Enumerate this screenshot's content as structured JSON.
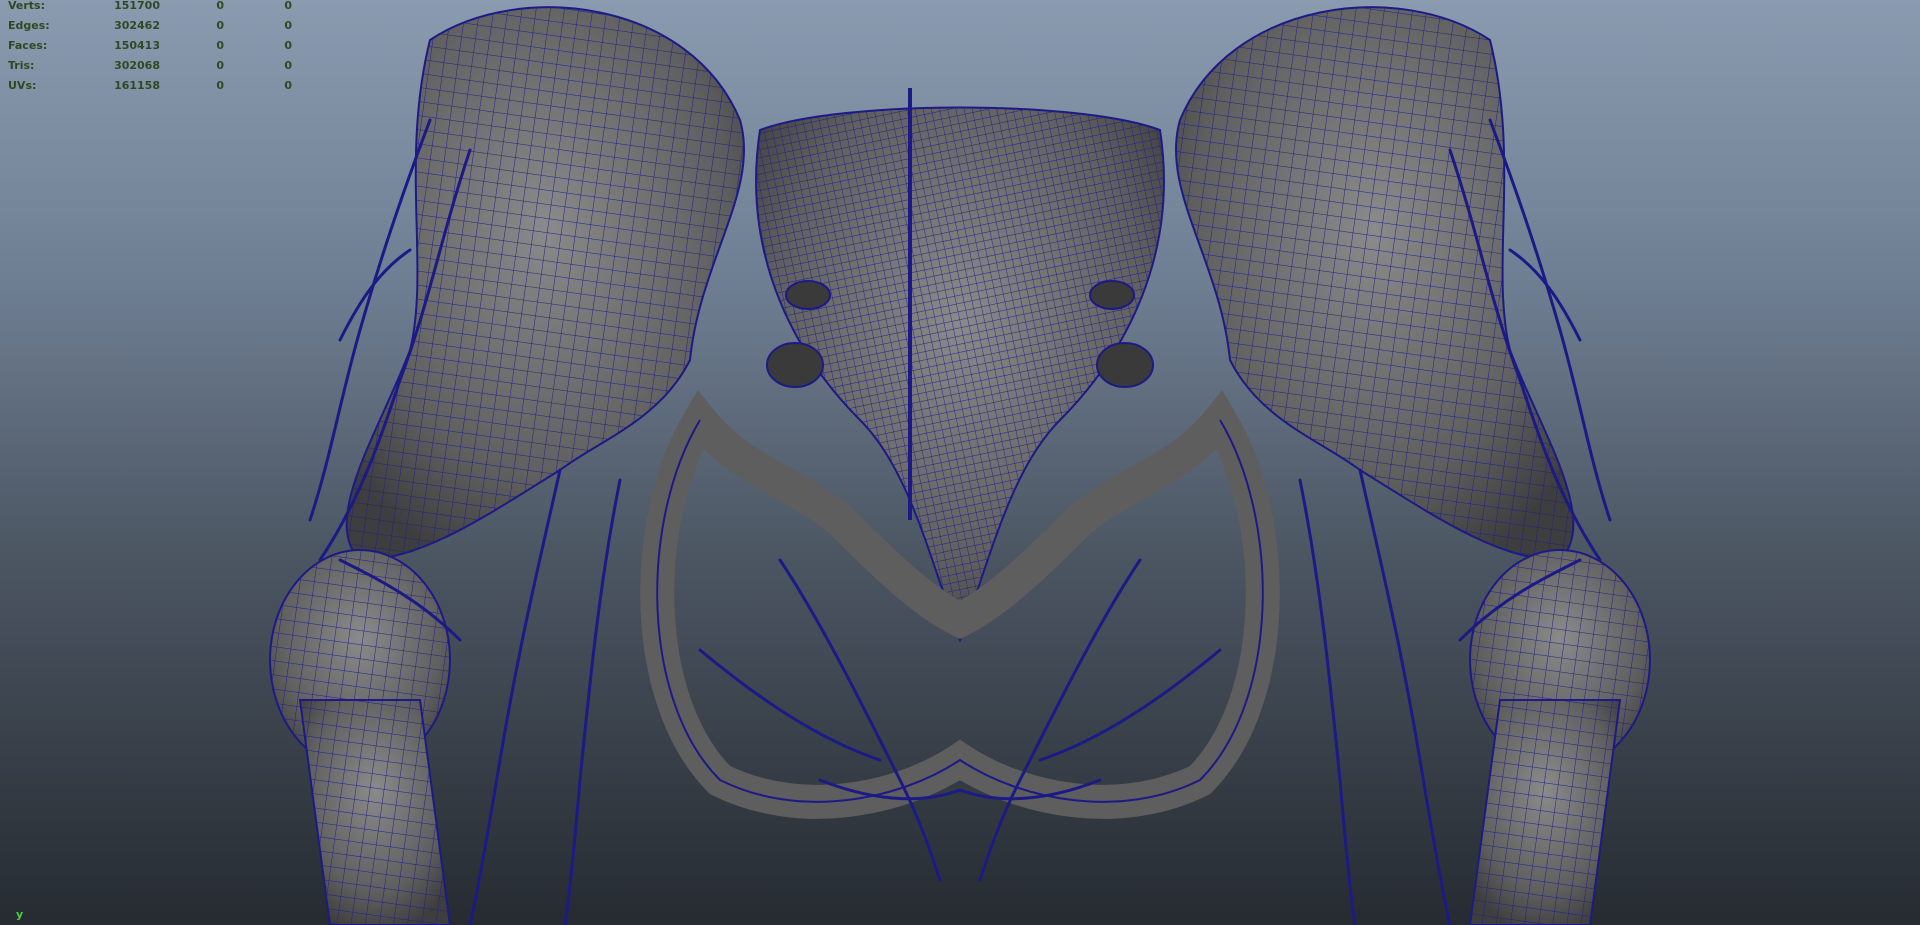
{
  "hud": {
    "rows": [
      {
        "label": "Verts:",
        "v1": "151700",
        "v2": "0",
        "v3": "0"
      },
      {
        "label": "Edges:",
        "v1": "302462",
        "v2": "0",
        "v3": "0"
      },
      {
        "label": "Faces:",
        "v1": "150413",
        "v2": "0",
        "v3": "0"
      },
      {
        "label": "Tris:",
        "v1": "302068",
        "v2": "0",
        "v3": "0"
      },
      {
        "label": "UVs:",
        "v1": "161158",
        "v2": "0",
        "v3": "0"
      }
    ]
  },
  "axis": {
    "label": "y"
  },
  "colors": {
    "bg_top": "#8a9aaf",
    "bg_bottom": "#262b31",
    "bone": "#6f6f6f",
    "wire": "#1c1a86",
    "hud_text": "#2e4a24",
    "axis_text": "#4cd13a"
  }
}
